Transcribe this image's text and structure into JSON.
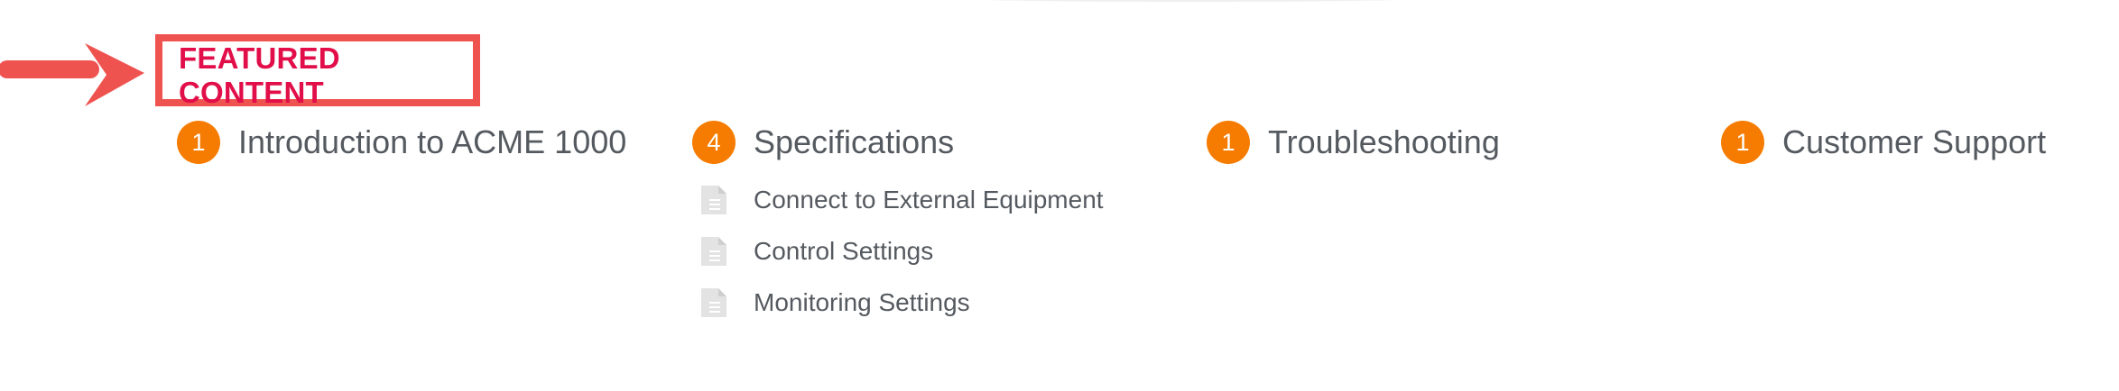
{
  "featured": {
    "title": "FEATURED CONTENT"
  },
  "colors": {
    "accent": "#e10e49",
    "highlight_box": "#ef5350",
    "badge": "#f57c00",
    "text": "#555a60",
    "doc_icon": "#e3e3e3"
  },
  "categories": [
    {
      "count": "1",
      "title": "Introduction to ACME 1000",
      "articles": []
    },
    {
      "count": "4",
      "title": "Specifications",
      "articles": [
        {
          "title": "Connect to External Equipment",
          "icon": "document-icon"
        },
        {
          "title": "Control Settings",
          "icon": "document-icon"
        },
        {
          "title": "Monitoring Settings",
          "icon": "document-icon"
        }
      ]
    },
    {
      "count": "1",
      "title": "Troubleshooting",
      "articles": []
    },
    {
      "count": "1",
      "title": "Customer Support",
      "articles": []
    }
  ]
}
